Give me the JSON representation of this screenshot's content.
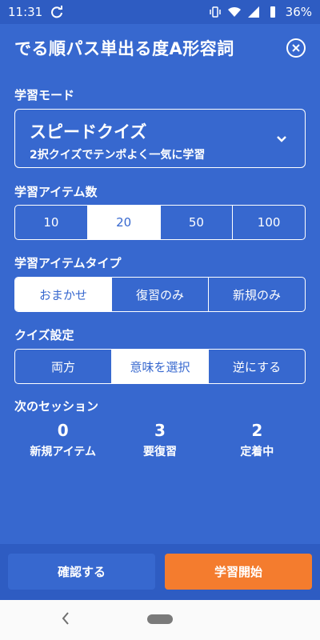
{
  "status": {
    "time": "11:31",
    "battery": "36%"
  },
  "header": {
    "title": "でる順パス単出る度A形容詞"
  },
  "mode": {
    "label": "学習モード",
    "name": "スピードクイズ",
    "description": "2択クイズでテンポよく一気に学習"
  },
  "item_count": {
    "label": "学習アイテム数",
    "options": [
      "10",
      "20",
      "50",
      "100"
    ],
    "selected": "20"
  },
  "item_type": {
    "label": "学習アイテムタイプ",
    "options": [
      "おまかせ",
      "復習のみ",
      "新規のみ"
    ],
    "selected": "おまかせ"
  },
  "quiz_settings": {
    "label": "クイズ設定",
    "options": [
      "両方",
      "意味を選択",
      "逆にする"
    ],
    "selected": "意味を選択"
  },
  "next_session": {
    "label": "次のセッション",
    "stats": [
      {
        "value": "0",
        "label": "新規アイテム"
      },
      {
        "value": "3",
        "label": "要復習"
      },
      {
        "value": "2",
        "label": "定着中"
      }
    ]
  },
  "buttons": {
    "confirm": "確認する",
    "start": "学習開始"
  },
  "colors": {
    "primary": "#3768cf",
    "accent": "#f47c2e"
  }
}
